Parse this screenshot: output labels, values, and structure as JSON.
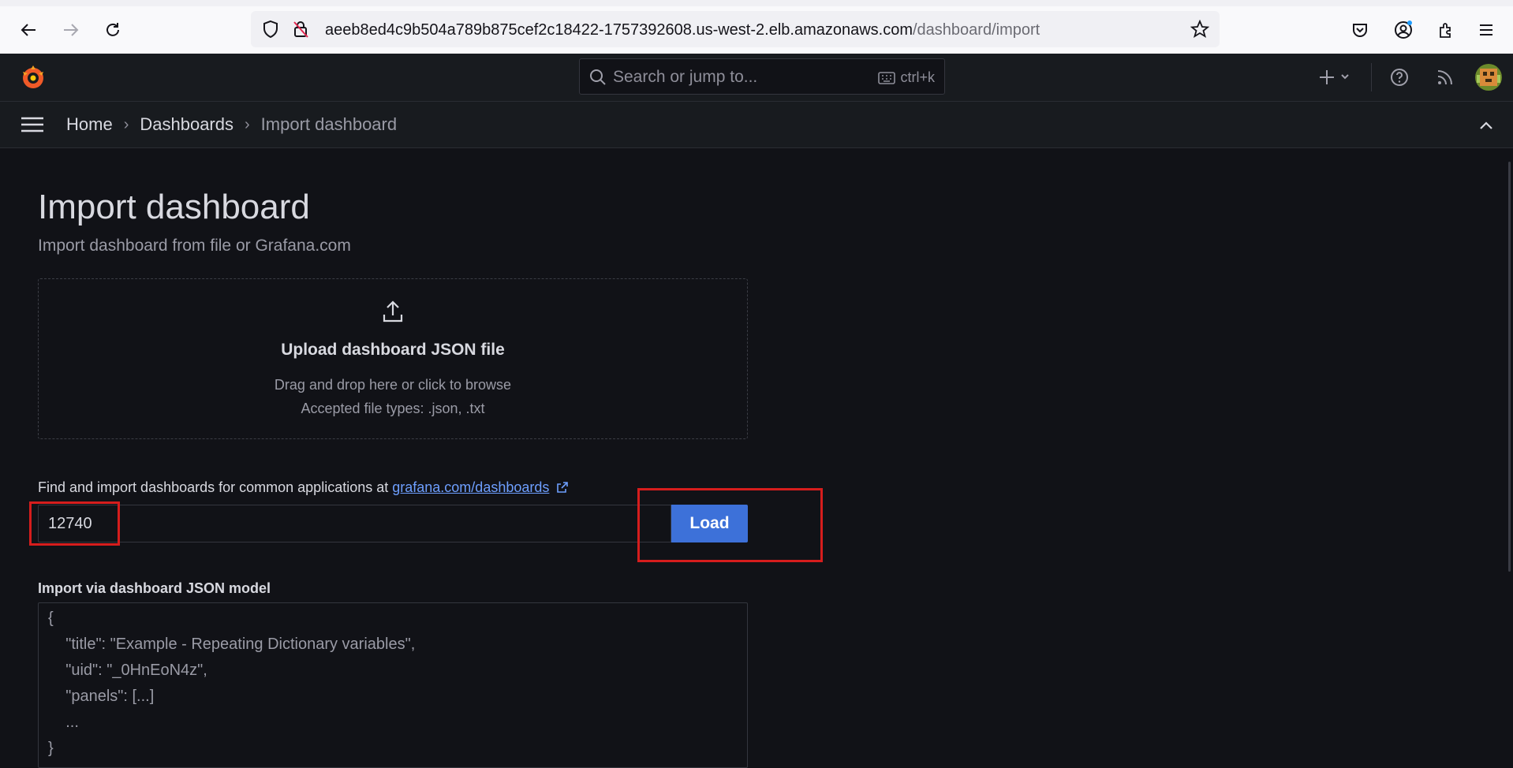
{
  "browser": {
    "url_host": "aeeb8ed4c9b504a789b875cef2c18422-1757392608.us-west-2.elb.amazonaws.com",
    "url_path": "/dashboard/import"
  },
  "topbar": {
    "search_placeholder": "Search or jump to...",
    "search_shortcut": "ctrl+k"
  },
  "breadcrumb": {
    "items": [
      "Home",
      "Dashboards",
      "Import dashboard"
    ]
  },
  "page": {
    "title": "Import dashboard",
    "subtitle": "Import dashboard from file or Grafana.com"
  },
  "upload": {
    "title": "Upload dashboard JSON file",
    "hint": "Drag and drop here or click to browse",
    "accepted": "Accepted file types: .json, .txt"
  },
  "grafana_com": {
    "label": "Find and import dashboards for common applications at",
    "link_text": "grafana.com/dashboards",
    "input_value": "12740",
    "load_label": "Load"
  },
  "json_model": {
    "label": "Import via dashboard JSON model",
    "lines": [
      "{",
      "    \"title\": \"Example - Repeating Dictionary variables\",",
      "    \"uid\": \"_0HnEoN4z\",",
      "    \"panels\": [...]",
      "    ...",
      "}"
    ]
  },
  "colors": {
    "accent": "#3d71d9",
    "highlight": "#d61d1d",
    "background": "#111217",
    "link": "#6e9fff"
  }
}
